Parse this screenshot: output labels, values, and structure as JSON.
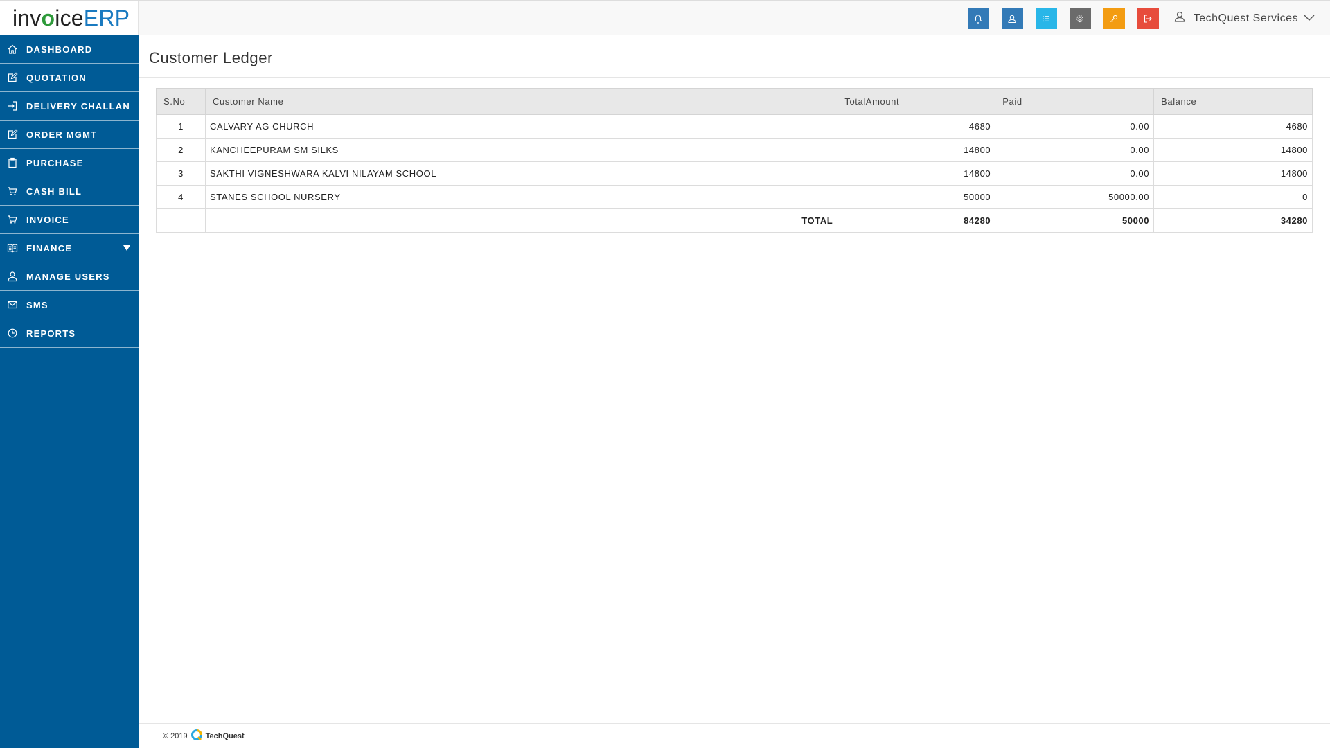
{
  "app": {
    "logo_part1": "inv",
    "logo_check": "o",
    "logo_part2": "ice",
    "logo_part3": "ERP"
  },
  "topbar": {
    "icons": [
      {
        "name": "bell-icon",
        "color": "#337ab7"
      },
      {
        "name": "users-icon",
        "color": "#337ab7"
      },
      {
        "name": "list-icon",
        "color": "#29b6e8"
      },
      {
        "name": "gear-icon",
        "color": "#6b6b6b"
      },
      {
        "name": "key-icon",
        "color": "#f39c12"
      },
      {
        "name": "logout-icon",
        "color": "#e74c3c"
      }
    ],
    "user_name": "TechQuest Services"
  },
  "sidebar": {
    "items": [
      {
        "label": "DASHBOARD",
        "icon": "home-icon"
      },
      {
        "label": "QUOTATION",
        "icon": "edit-icon"
      },
      {
        "label": "DELIVERY CHALLAN",
        "icon": "sign-in-icon"
      },
      {
        "label": "ORDER MGMT",
        "icon": "edit-icon"
      },
      {
        "label": "PURCHASE",
        "icon": "clipboard-icon"
      },
      {
        "label": "CASH BILL",
        "icon": "cart-icon"
      },
      {
        "label": "INVOICE",
        "icon": "cart-icon"
      },
      {
        "label": "FINANCE",
        "icon": "book-icon"
      },
      {
        "label": "MANAGE USERS",
        "icon": "user-icon"
      },
      {
        "label": "SMS",
        "icon": "envelope-icon"
      },
      {
        "label": "REPORTS",
        "icon": "clock-icon"
      }
    ]
  },
  "page": {
    "title": "Customer Ledger"
  },
  "table": {
    "headers": [
      "S.No",
      "Customer Name",
      "TotalAmount",
      "Paid",
      "Balance"
    ],
    "rows": [
      {
        "sno": "1",
        "name": "CALVARY AG CHURCH",
        "total": "4680",
        "paid": "0.00",
        "balance": "4680"
      },
      {
        "sno": "2",
        "name": "KANCHEEPURAM SM SILKS",
        "total": "14800",
        "paid": "0.00",
        "balance": "14800"
      },
      {
        "sno": "3",
        "name": "SAKTHI VIGNESHWARA KALVI NILAYAM SCHOOL",
        "total": "14800",
        "paid": "0.00",
        "balance": "14800"
      },
      {
        "sno": "4",
        "name": "STANES SCHOOL NURSERY",
        "total": "50000",
        "paid": "50000.00",
        "balance": "0"
      }
    ],
    "total_label": "TOTAL",
    "totals": {
      "total": "84280",
      "paid": "50000",
      "balance": "34280"
    }
  },
  "footer": {
    "copyright": "© 2019",
    "brand": "TechQuest"
  }
}
